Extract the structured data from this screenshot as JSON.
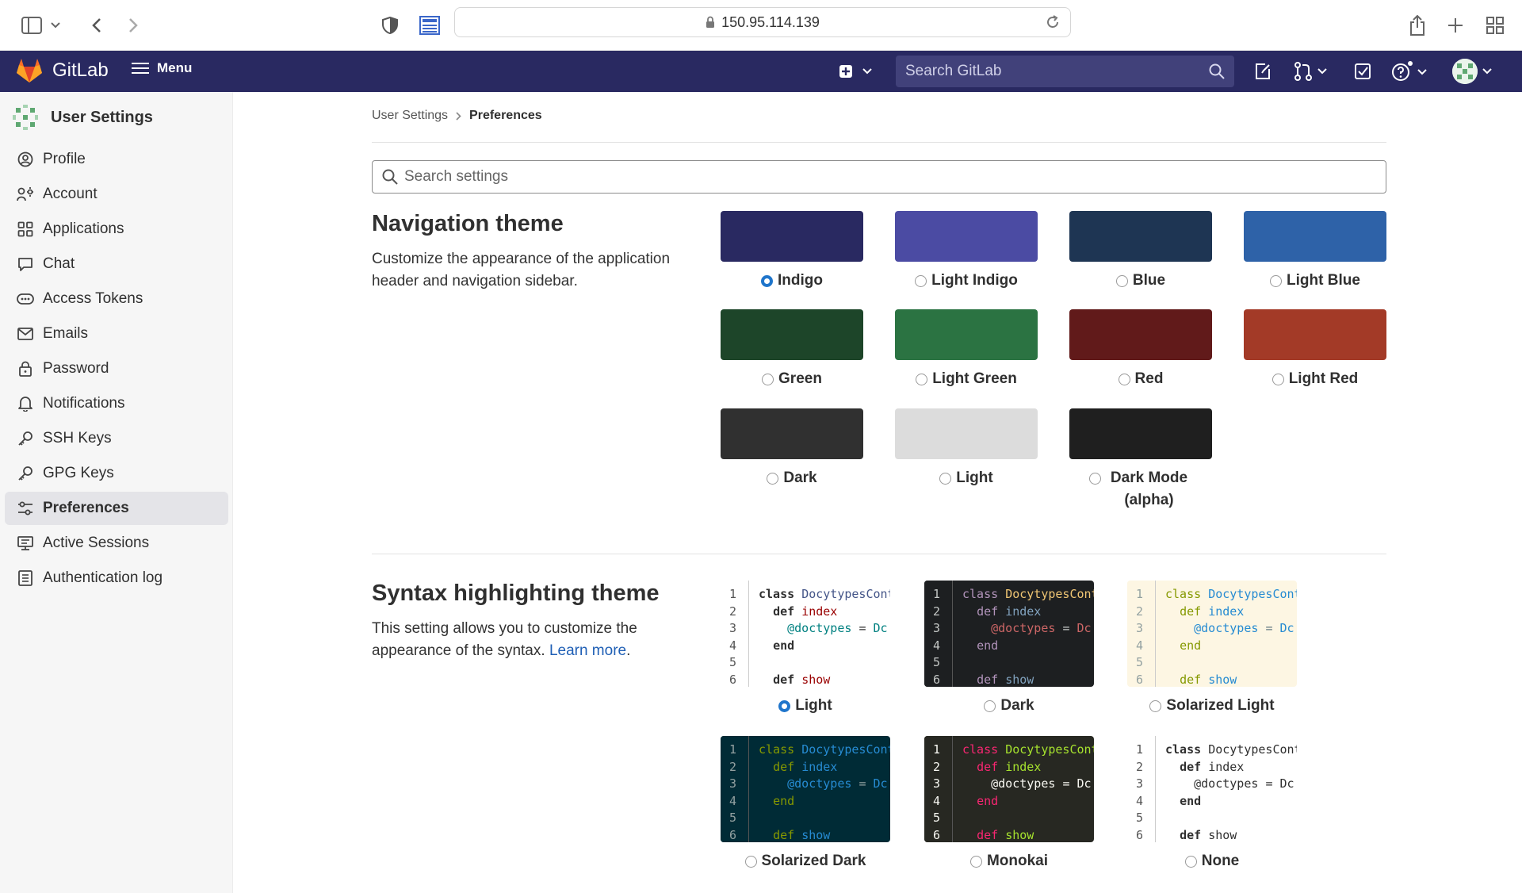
{
  "browser": {
    "address": "150.95.114.139"
  },
  "header": {
    "brand": "GitLab",
    "menu_label": "Menu",
    "search_placeholder": "Search GitLab"
  },
  "sidebar": {
    "title": "User Settings",
    "items": [
      {
        "label": "Profile",
        "icon": "profile-icon"
      },
      {
        "label": "Account",
        "icon": "account-icon"
      },
      {
        "label": "Applications",
        "icon": "applications-icon"
      },
      {
        "label": "Chat",
        "icon": "chat-icon"
      },
      {
        "label": "Access Tokens",
        "icon": "token-icon"
      },
      {
        "label": "Emails",
        "icon": "mail-icon"
      },
      {
        "label": "Password",
        "icon": "lock-icon"
      },
      {
        "label": "Notifications",
        "icon": "bell-icon"
      },
      {
        "label": "SSH Keys",
        "icon": "key-icon"
      },
      {
        "label": "GPG Keys",
        "icon": "key-icon"
      },
      {
        "label": "Preferences",
        "icon": "preferences-icon",
        "active": true
      },
      {
        "label": "Active Sessions",
        "icon": "monitor-icon"
      },
      {
        "label": "Authentication log",
        "icon": "log-icon"
      }
    ]
  },
  "breadcrumb": {
    "parent": "User Settings",
    "current": "Preferences"
  },
  "settings_search_placeholder": "Search settings",
  "navigation_theme": {
    "title": "Navigation theme",
    "description": "Customize the appearance of the application header and navigation sidebar.",
    "options": [
      {
        "label": "Indigo",
        "color": "#292961",
        "checked": true
      },
      {
        "label": "Light Indigo",
        "color": "#4b4ba3"
      },
      {
        "label": "Blue",
        "color": "#1e3553"
      },
      {
        "label": "Light Blue",
        "color": "#2e62a8"
      },
      {
        "label": "Green",
        "color": "#1d4529"
      },
      {
        "label": "Light Green",
        "color": "#2b7342"
      },
      {
        "label": "Red",
        "color": "#611a1a"
      },
      {
        "label": "Light Red",
        "color": "#a33a27"
      },
      {
        "label": "Dark",
        "color": "#303030"
      },
      {
        "label": "Light",
        "color": "#dcdcdc"
      },
      {
        "label": "Dark Mode (alpha)",
        "color": "#1f1f1f"
      }
    ]
  },
  "syntax_theme": {
    "title": "Syntax highlighting theme",
    "description": "This setting allows you to customize the appearance of the syntax.",
    "learn_more": "Learn more",
    "code_lines": [
      "class DocytypesCont",
      "  def index",
      "    @doctypes = Dc",
      "  end",
      "",
      "  def show"
    ],
    "line_numbers": [
      "1",
      "2",
      "3",
      "4",
      "5",
      "6"
    ],
    "options": [
      {
        "label": "Light",
        "checked": true,
        "bg": "#ffffff",
        "fg": "#303030",
        "gutter": "#ffffff",
        "num": "#555555",
        "keyword": "#303030",
        "cls": "#445588",
        "ivar": "#008080",
        "method": "#990000"
      },
      {
        "label": "Dark",
        "bg": "#1d1f21",
        "fg": "#c5c8c6",
        "gutter": "#1d1f21",
        "num": "#c5c8c6",
        "keyword": "#b294bb",
        "cls": "#f0c674",
        "ivar": "#cc6666",
        "method": "#81a2be"
      },
      {
        "label": "Solarized Light",
        "bg": "#fdf6e3",
        "fg": "#657b83",
        "gutter": "#fdf6e3",
        "num": "#93a1a1",
        "keyword": "#859900",
        "cls": "#268bd2",
        "ivar": "#268bd2",
        "method": "#268bd2"
      },
      {
        "label": "Solarized Dark",
        "bg": "#002b36",
        "fg": "#93a1a1",
        "gutter": "#002b36",
        "num": "#93a1a1",
        "keyword": "#859900",
        "cls": "#268bd2",
        "ivar": "#268bd2",
        "method": "#268bd2"
      },
      {
        "label": "Monokai",
        "bg": "#272822",
        "fg": "#f8f8f2",
        "gutter": "#272822",
        "num": "#f8f8f2",
        "keyword": "#f92672",
        "cls": "#a6e22e",
        "ivar": "#f8f8f2",
        "method": "#a6e22e"
      },
      {
        "label": "None",
        "bg": "#ffffff",
        "fg": "#303030",
        "gutter": "#ffffff",
        "num": "#555555",
        "keyword": "#303030",
        "cls": "#303030",
        "ivar": "#303030",
        "method": "#303030"
      }
    ]
  }
}
